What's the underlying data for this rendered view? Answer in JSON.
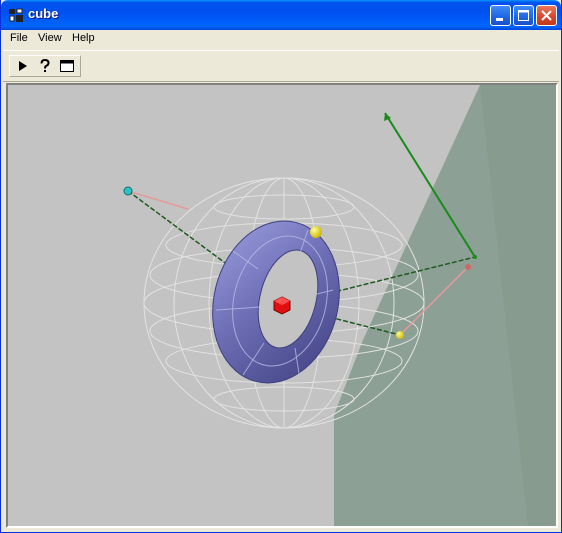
{
  "window": {
    "title": "cube",
    "icon": "tools-icon"
  },
  "titlebar_buttons": {
    "minimize": "minimize-icon",
    "maximize": "maximize-icon",
    "close": "close-icon"
  },
  "menu": {
    "items": [
      {
        "label": "File"
      },
      {
        "label": "View"
      },
      {
        "label": "Help"
      }
    ]
  },
  "toolbar": {
    "buttons": [
      {
        "icon": "play-icon"
      },
      {
        "icon": "help-question-icon"
      },
      {
        "icon": "window-icon"
      }
    ]
  },
  "scene": {
    "background_color": "#c3c3c3",
    "wall_color": "#8ca095",
    "torus_color": "#6e6fb6",
    "wireframe_color": "#e2e2e2",
    "axis_color": "#1c8a1c",
    "link_color": "#1f5a1f",
    "accent_line_color": "#e69a9a"
  }
}
